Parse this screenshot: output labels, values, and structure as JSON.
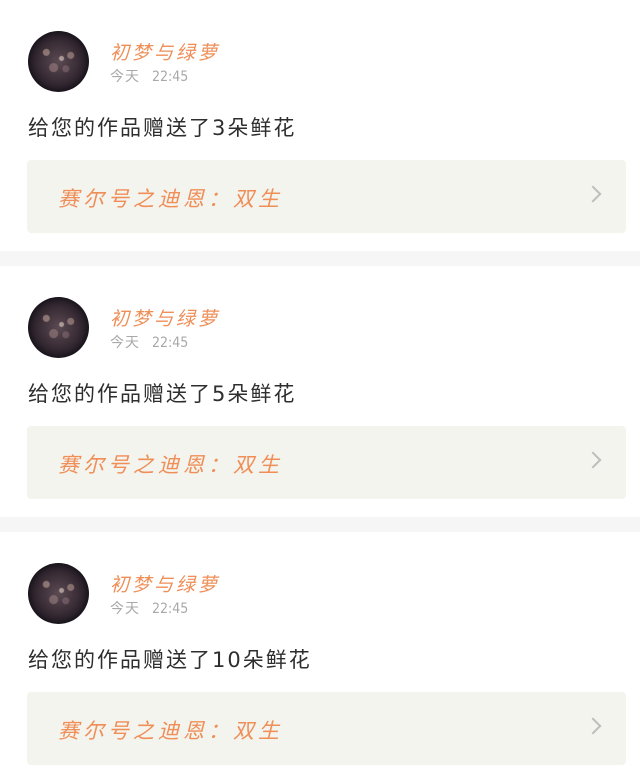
{
  "feed": {
    "items": [
      {
        "username": "初梦与绿萝",
        "day": "今天",
        "time": "22:45",
        "message": "给您的作品赠送了3朵鲜花",
        "work_title": "赛尔号之迪恩：双生"
      },
      {
        "username": "初梦与绿萝",
        "day": "今天",
        "time": "22:45",
        "message": "给您的作品赠送了5朵鲜花",
        "work_title": "赛尔号之迪恩：双生"
      },
      {
        "username": "初梦与绿萝",
        "day": "今天",
        "time": "22:45",
        "message": "给您的作品赠送了10朵鲜花",
        "work_title": "赛尔号之迪恩：双生"
      }
    ]
  },
  "icons": {
    "avatar": "avatar-image",
    "chevron": "chevron-right-icon"
  },
  "colors": {
    "accent": "#ef8e57",
    "link_card_bg": "#f4f4ee",
    "divider": "#f6f6f6",
    "timestamp": "#a9a9a9"
  }
}
